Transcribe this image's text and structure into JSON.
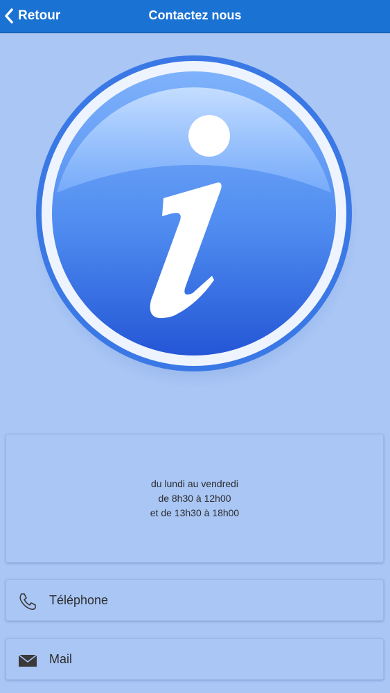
{
  "header": {
    "back_label": "Retour",
    "title": "Contactez nous"
  },
  "hours": {
    "line1": "du lundi au vendredi",
    "line2": "de 8h30 à 12h00",
    "line3": "et de 13h30 à 18h00"
  },
  "actions": [
    {
      "label": "Téléphone",
      "icon": "phone-icon"
    },
    {
      "label": "Mail",
      "icon": "envelope-icon"
    }
  ],
  "colors": {
    "header": "#1a72d3",
    "background": "#a9c6f5",
    "info_blue": "#3b74e3"
  }
}
